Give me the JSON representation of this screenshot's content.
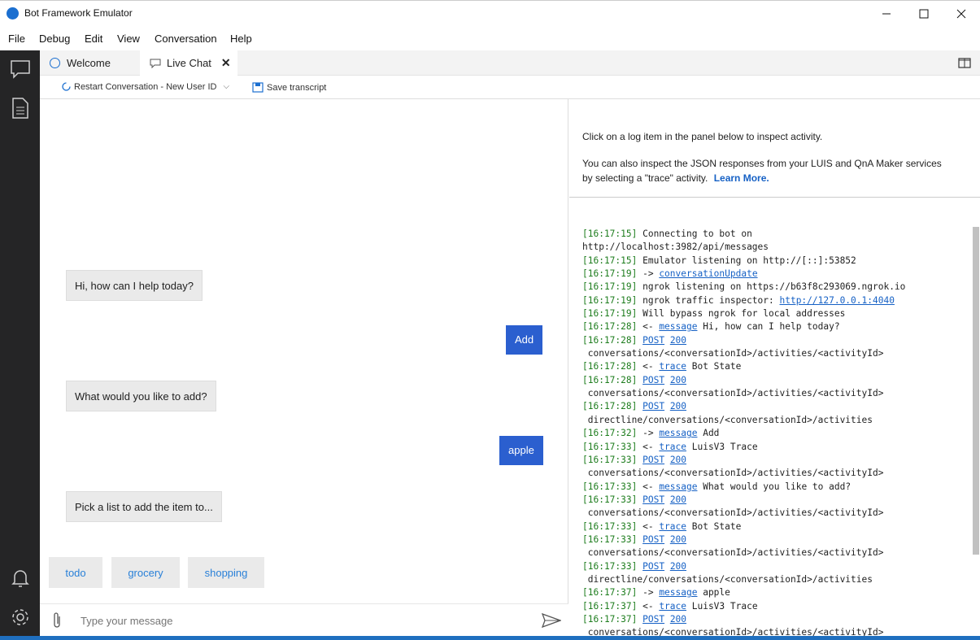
{
  "window": {
    "title": "Bot Framework Emulator"
  },
  "menu": [
    "File",
    "Debug",
    "Edit",
    "View",
    "Conversation",
    "Help"
  ],
  "tabs": {
    "welcome": "Welcome",
    "live_chat": "Live Chat"
  },
  "toolbar": {
    "restart": "Restart Conversation - New User ID",
    "save": "Save transcript"
  },
  "chat": {
    "bot1": "Hi, how can I help today?",
    "user1": "Add",
    "bot2": "What would you like to add?",
    "user2": "apple",
    "bot3": "Pick a list to add the item to...",
    "suggestions": [
      "todo",
      "grocery",
      "shopping"
    ],
    "input_placeholder": "Type your message"
  },
  "inspector": {
    "line1": "Click on a log item in the panel below to inspect activity.",
    "line2": "You can also inspect the JSON responses from your LUIS and QnA Maker services",
    "line3": "by selecting a \"trace\" activity.",
    "learn_more": "Learn More."
  },
  "log": [
    {
      "t": "[16:17:15]",
      "parts": [
        {
          "s": " Connecting to bot on"
        }
      ]
    },
    {
      "t": "",
      "parts": [
        {
          "s": "http://localhost:3982/api/messages"
        }
      ]
    },
    {
      "t": "[16:17:15]",
      "parts": [
        {
          "s": " Emulator listening on http://[::]:53852"
        }
      ]
    },
    {
      "t": "[16:17:19]",
      "parts": [
        {
          "s": " -> "
        },
        {
          "l": "conversationUpdate"
        }
      ]
    },
    {
      "t": "[16:17:19]",
      "parts": [
        {
          "s": " ngrok listening on https://b63f8c293069.ngrok.io"
        }
      ]
    },
    {
      "t": "[16:17:19]",
      "parts": [
        {
          "s": " ngrok traffic inspector: "
        },
        {
          "l": "http://127.0.0.1:4040"
        }
      ]
    },
    {
      "t": "[16:17:19]",
      "parts": [
        {
          "s": " Will bypass ngrok for local addresses"
        }
      ]
    },
    {
      "t": "[16:17:28]",
      "parts": [
        {
          "s": " <- "
        },
        {
          "l": "message"
        },
        {
          "s": " Hi, how can I help today?"
        }
      ]
    },
    {
      "t": "[16:17:28]",
      "parts": [
        {
          "s": " "
        },
        {
          "l": "POST"
        },
        {
          "s": " "
        },
        {
          "l": "200"
        }
      ]
    },
    {
      "t": "",
      "parts": [
        {
          "s": " conversations/<conversationId>/activities/<activityId>"
        }
      ]
    },
    {
      "t": "[16:17:28]",
      "parts": [
        {
          "s": " <- "
        },
        {
          "l": "trace"
        },
        {
          "s": " Bot State"
        }
      ]
    },
    {
      "t": "[16:17:28]",
      "parts": [
        {
          "s": " "
        },
        {
          "l": "POST"
        },
        {
          "s": " "
        },
        {
          "l": "200"
        }
      ]
    },
    {
      "t": "",
      "parts": [
        {
          "s": " conversations/<conversationId>/activities/<activityId>"
        }
      ]
    },
    {
      "t": "[16:17:28]",
      "parts": [
        {
          "s": " "
        },
        {
          "l": "POST"
        },
        {
          "s": " "
        },
        {
          "l": "200"
        }
      ]
    },
    {
      "t": "",
      "parts": [
        {
          "s": " directline/conversations/<conversationId>/activities"
        }
      ]
    },
    {
      "t": "[16:17:32]",
      "parts": [
        {
          "s": " -> "
        },
        {
          "l": "message"
        },
        {
          "s": " Add"
        }
      ]
    },
    {
      "t": "[16:17:33]",
      "parts": [
        {
          "s": " <- "
        },
        {
          "l": "trace"
        },
        {
          "s": " LuisV3 Trace"
        }
      ]
    },
    {
      "t": "[16:17:33]",
      "parts": [
        {
          "s": " "
        },
        {
          "l": "POST"
        },
        {
          "s": " "
        },
        {
          "l": "200"
        }
      ]
    },
    {
      "t": "",
      "parts": [
        {
          "s": " conversations/<conversationId>/activities/<activityId>"
        }
      ]
    },
    {
      "t": "[16:17:33]",
      "parts": [
        {
          "s": " <- "
        },
        {
          "l": "message"
        },
        {
          "s": " What would you like to add?"
        }
      ]
    },
    {
      "t": "[16:17:33]",
      "parts": [
        {
          "s": " "
        },
        {
          "l": "POST"
        },
        {
          "s": " "
        },
        {
          "l": "200"
        }
      ]
    },
    {
      "t": "",
      "parts": [
        {
          "s": " conversations/<conversationId>/activities/<activityId>"
        }
      ]
    },
    {
      "t": "[16:17:33]",
      "parts": [
        {
          "s": " <- "
        },
        {
          "l": "trace"
        },
        {
          "s": " Bot State"
        }
      ]
    },
    {
      "t": "[16:17:33]",
      "parts": [
        {
          "s": " "
        },
        {
          "l": "POST"
        },
        {
          "s": " "
        },
        {
          "l": "200"
        }
      ]
    },
    {
      "t": "",
      "parts": [
        {
          "s": " conversations/<conversationId>/activities/<activityId>"
        }
      ]
    },
    {
      "t": "[16:17:33]",
      "parts": [
        {
          "s": " "
        },
        {
          "l": "POST"
        },
        {
          "s": " "
        },
        {
          "l": "200"
        }
      ]
    },
    {
      "t": "",
      "parts": [
        {
          "s": " directline/conversations/<conversationId>/activities"
        }
      ]
    },
    {
      "t": "[16:17:37]",
      "parts": [
        {
          "s": " -> "
        },
        {
          "l": "message"
        },
        {
          "s": " apple"
        }
      ]
    },
    {
      "t": "[16:17:37]",
      "parts": [
        {
          "s": " <- "
        },
        {
          "l": "trace"
        },
        {
          "s": " LuisV3 Trace"
        }
      ]
    },
    {
      "t": "[16:17:37]",
      "parts": [
        {
          "s": " "
        },
        {
          "l": "POST"
        },
        {
          "s": " "
        },
        {
          "l": "200"
        }
      ]
    },
    {
      "t": "",
      "parts": [
        {
          "s": " conversations/<conversationId>/activities/<activityId>"
        }
      ]
    }
  ]
}
